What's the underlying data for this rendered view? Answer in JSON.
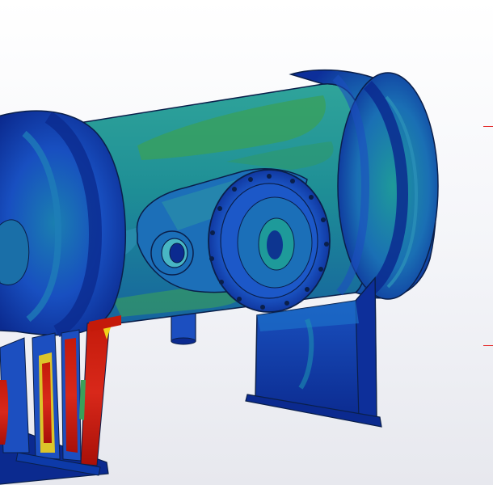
{
  "viewport": {
    "background_top": "#ffffff",
    "background_bottom": "#e7e8ee"
  },
  "model": {
    "colors": {
      "low": "#0b2a8f",
      "low_mid": "#1c4fc0",
      "mid": "#1b8f8f",
      "mid_high": "#3aa05a",
      "high_mid": "#f2d21a",
      "high": "#c41a0a",
      "edge": "#0a1f4a"
    },
    "parts": [
      "pressure-vessel-shell",
      "left-end-cap",
      "right-end-cap",
      "side-nozzle-flange",
      "saddle-support-right",
      "saddle-support-left",
      "bottom-drain-nozzle"
    ]
  },
  "annotations": [
    {
      "color": "#e53030"
    },
    {
      "color": "#e53030"
    }
  ]
}
